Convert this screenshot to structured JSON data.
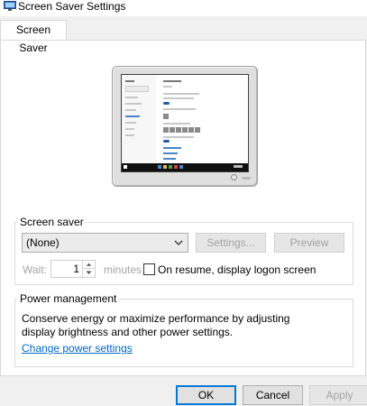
{
  "window": {
    "title": "Screen Saver Settings",
    "icon": "screen-saver-app-icon"
  },
  "tabs": [
    {
      "label": "Screen Saver",
      "active": true
    }
  ],
  "screen_saver": {
    "group_title": "Screen saver",
    "selected_option": "(None)",
    "settings_button": "Settings...",
    "preview_button": "Preview",
    "wait_label": "Wait:",
    "wait_value": "1",
    "minutes_label": "minutes",
    "resume_checkbox_label": "On resume, display logon screen",
    "resume_checked": false
  },
  "power_management": {
    "group_title": "Power management",
    "description": "Conserve energy or maximize performance by adjusting display brightness and other power settings.",
    "link_label": "Change power settings"
  },
  "dialog_buttons": {
    "ok": "OK",
    "cancel": "Cancel",
    "apply": "Apply"
  },
  "colors": {
    "accent": "#0078d7",
    "link": "#0066cc",
    "disabled_text": "#a3a3a3"
  }
}
